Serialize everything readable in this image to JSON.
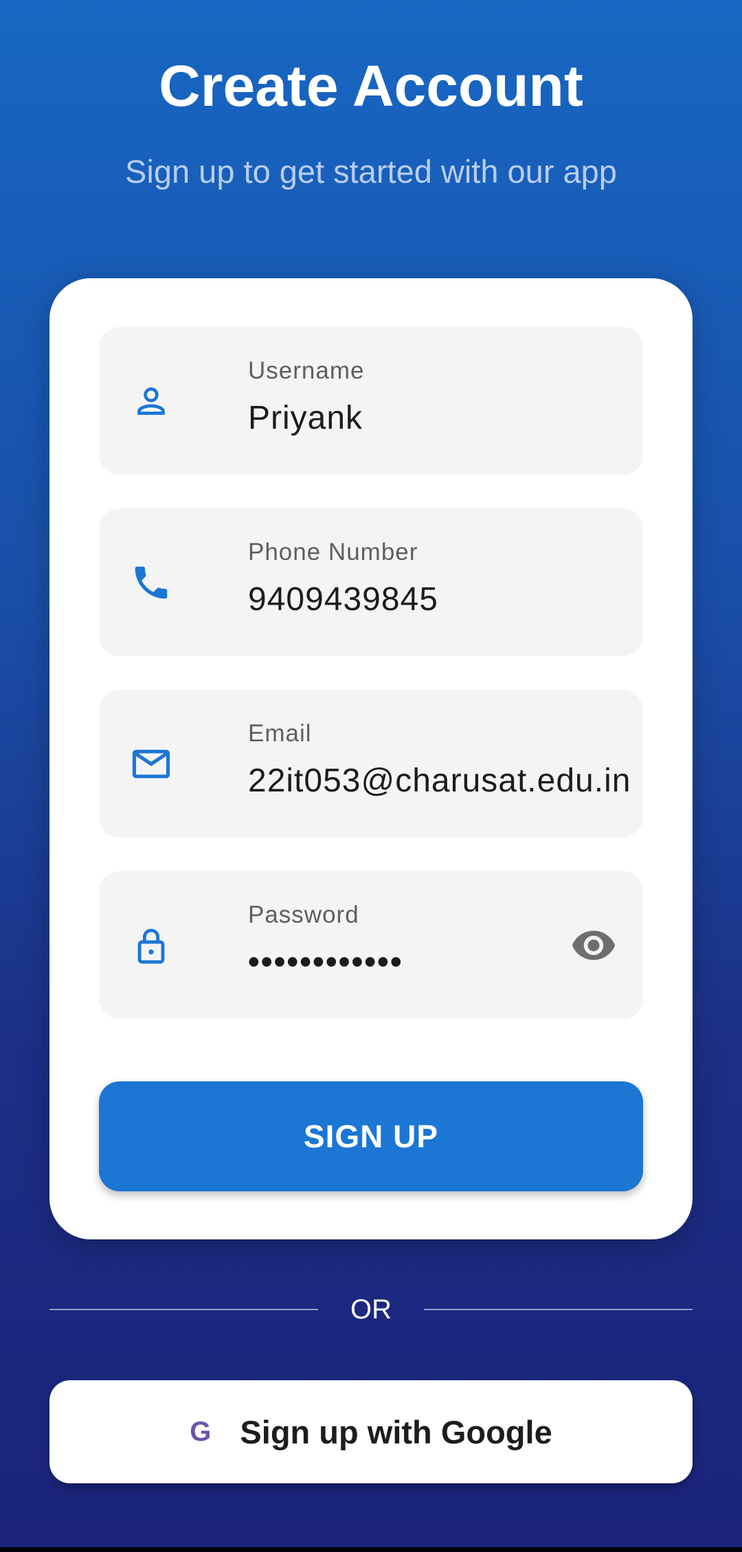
{
  "header": {
    "title": "Create Account",
    "subtitle": "Sign up to get started with our app"
  },
  "form": {
    "fields": [
      {
        "label": "Username",
        "value": "Priyank",
        "icon": "person-icon"
      },
      {
        "label": "Phone Number",
        "value": "9409439845",
        "icon": "phone-icon"
      },
      {
        "label": "Email",
        "value": "22it053@charusat.edu.in",
        "icon": "mail-icon"
      },
      {
        "label": "Password",
        "value": "••••••••••••",
        "icon": "lock-icon",
        "toggle_icon": "eye-icon"
      }
    ],
    "submit_label": "SIGN UP"
  },
  "divider": {
    "text": "OR"
  },
  "google": {
    "icon_text": "G",
    "label": "Sign up with Google"
  },
  "colors": {
    "accent": "#1b76d4",
    "background_top": "#1767c3",
    "background_bottom": "#1b237a"
  }
}
